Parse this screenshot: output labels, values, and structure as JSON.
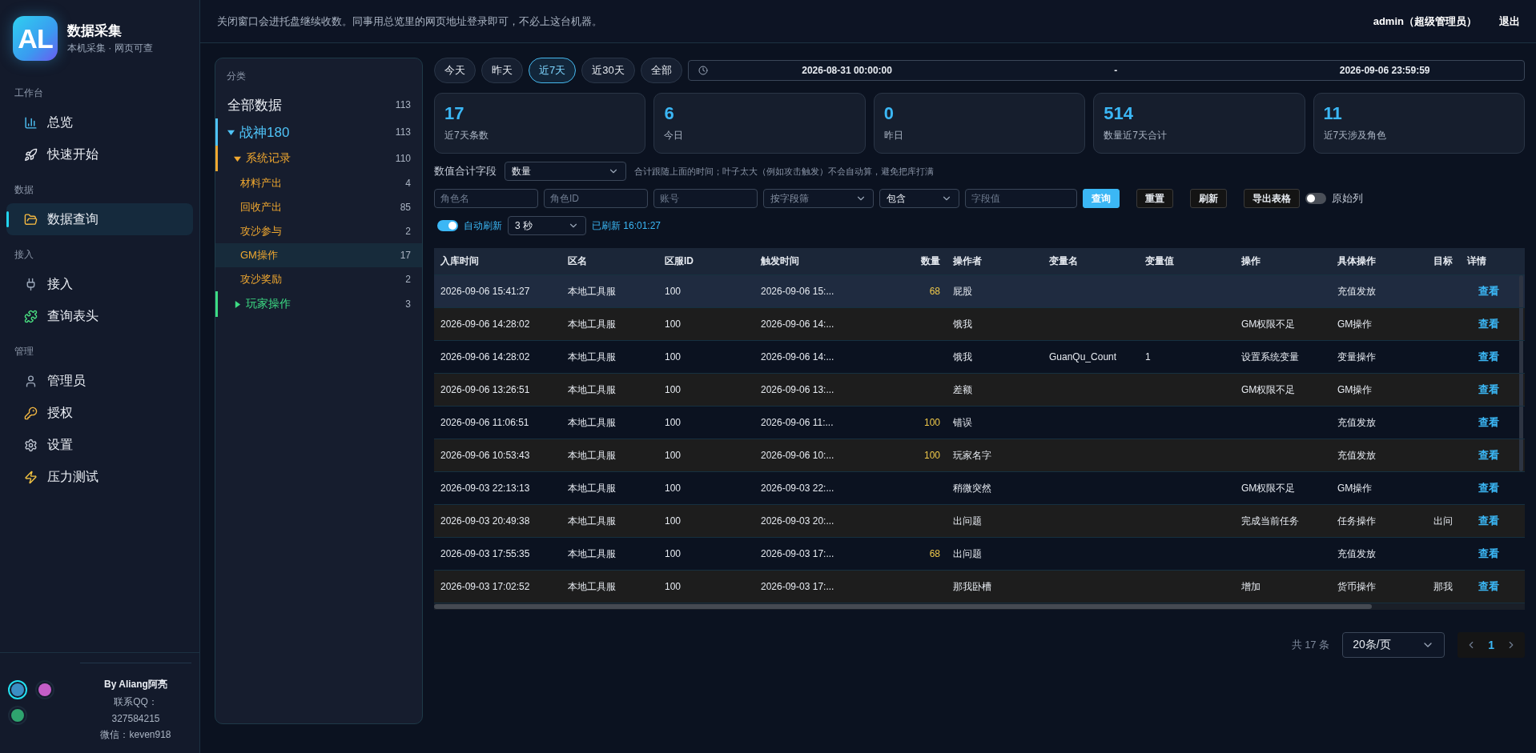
{
  "app": {
    "logo": "AL",
    "title": "数据采集",
    "subtitle": "本机采集 · 网页可查"
  },
  "nav": [
    {
      "section": "工作台",
      "items": [
        {
          "label": "总览",
          "selected": false
        },
        {
          "label": "快速开始",
          "selected": false
        }
      ]
    },
    {
      "section": "数据",
      "items": [
        {
          "label": "数据查询",
          "selected": true
        }
      ]
    },
    {
      "section": "接入",
      "items": [
        {
          "label": "接入",
          "selected": false
        },
        {
          "label": "查询表头",
          "selected": false
        }
      ]
    },
    {
      "section": "管理",
      "items": [
        {
          "label": "管理员",
          "selected": false
        },
        {
          "label": "授权",
          "selected": false
        },
        {
          "label": "设置",
          "selected": false
        },
        {
          "label": "压力测试",
          "selected": false
        }
      ]
    }
  ],
  "themes": [
    {
      "color": "#3a8fc4",
      "selected": true
    },
    {
      "color": "#c45ec8",
      "selected": false
    },
    {
      "color": "#2fa36e",
      "selected": false
    }
  ],
  "credits": {
    "author": "By Aliang阿亮",
    "qq_label": "联系QQ：",
    "qq": "327584215",
    "wechat": "微信：keven918"
  },
  "header": {
    "notice": "关闭窗口会进托盘继续收数。同事用总览里的网页地址登录即可，不必上这台机器。",
    "user": "admin（超级管理员）",
    "logout": "退出"
  },
  "categories": {
    "title": "分类",
    "tree": [
      {
        "label": "全部数据",
        "count": "113",
        "selected": false
      },
      {
        "label": "战神180",
        "count": "113",
        "color": "#4fc3f7",
        "expanded": true,
        "selected": false,
        "children": [
          {
            "label": "系统记录",
            "count": "110",
            "color": "#f0a830",
            "expanded": true,
            "selected": false,
            "children": [
              {
                "label": "材料产出",
                "count": "4",
                "selected": false
              },
              {
                "label": "回收产出",
                "count": "85",
                "selected": false
              },
              {
                "label": "攻沙参与",
                "count": "2",
                "selected": false
              },
              {
                "label": "GM操作",
                "count": "17",
                "selected": true
              },
              {
                "label": "攻沙奖励",
                "count": "2",
                "selected": false
              }
            ]
          },
          {
            "label": "玩家操作",
            "count": "3",
            "color": "#3ddc84",
            "expanded": false,
            "selected": false
          }
        ]
      }
    ]
  },
  "ranges": [
    {
      "label": "今天",
      "selected": false
    },
    {
      "label": "昨天",
      "selected": false
    },
    {
      "label": "近7天",
      "selected": true
    },
    {
      "label": "近30天",
      "selected": false
    },
    {
      "label": "全部",
      "selected": false
    }
  ],
  "date_range": {
    "start": "2026-08-31 00:00:00",
    "separator": "-",
    "end": "2026-09-06 23:59:59"
  },
  "stats": [
    {
      "value": "17",
      "label": "近7天条数"
    },
    {
      "value": "6",
      "label": "今日"
    },
    {
      "value": "0",
      "label": "昨日"
    },
    {
      "value": "514",
      "label": "数量近7天合计"
    },
    {
      "value": "11",
      "label": "近7天涉及角色"
    }
  ],
  "sum_field": {
    "label": "数值合计字段",
    "value": "数量",
    "hint": "合计跟随上面的时间；叶子太大（例如攻击触发）不会自动算，避免把库打满"
  },
  "filters": {
    "role_name": {
      "placeholder": "角色名"
    },
    "role_id": {
      "placeholder": "角色ID"
    },
    "account": {
      "placeholder": "账号"
    },
    "field_select": {
      "placeholder": "按字段筛"
    },
    "match_select": {
      "value": "包含"
    },
    "field_value": {
      "placeholder": "字段值"
    },
    "buttons": [
      {
        "label": "查询",
        "kind": "primary"
      },
      {
        "label": "重置",
        "kind": "plain"
      },
      {
        "label": "刷新",
        "kind": "plain"
      },
      {
        "label": "导出表格",
        "kind": "plain"
      }
    ],
    "raw_columns": {
      "label": "原始列",
      "on": false
    }
  },
  "auto_refresh": {
    "label": "自动刷新",
    "on": true,
    "interval": "3 秒",
    "status": "已刷新 16:01:27"
  },
  "table": {
    "columns": [
      "入库时间",
      "区名",
      "区服ID",
      "触发时间",
      "数量",
      "操作者",
      "变量名",
      "变量值",
      "操作",
      "具体操作",
      "目标",
      "详情"
    ],
    "rows": [
      {
        "selected": true,
        "cells": [
          "2026-09-06 15:41:27",
          "本地工具服",
          "100",
          "2026-09-06 15:...",
          "68",
          "屁股",
          "",
          "",
          "",
          "充值发放",
          "",
          "查看"
        ]
      },
      {
        "selected": false,
        "cells": [
          "2026-09-06 14:28:02",
          "本地工具服",
          "100",
          "2026-09-06 14:...",
          "",
          "饿我",
          "",
          "",
          "GM权限不足",
          "GM操作",
          "",
          "查看"
        ]
      },
      {
        "selected": false,
        "cells": [
          "2026-09-06 14:28:02",
          "本地工具服",
          "100",
          "2026-09-06 14:...",
          "",
          "饿我",
          "GuanQu_Count",
          "1",
          "设置系统变量",
          "变量操作",
          "",
          "查看"
        ]
      },
      {
        "selected": false,
        "cells": [
          "2026-09-06 13:26:51",
          "本地工具服",
          "100",
          "2026-09-06 13:...",
          "",
          "差额",
          "",
          "",
          "GM权限不足",
          "GM操作",
          "",
          "查看"
        ]
      },
      {
        "selected": false,
        "cells": [
          "2026-09-06 11:06:51",
          "本地工具服",
          "100",
          "2026-09-06 11:...",
          "100",
          "错误",
          "",
          "",
          "",
          "充值发放",
          "",
          "查看"
        ]
      },
      {
        "selected": false,
        "cells": [
          "2026-09-06 10:53:43",
          "本地工具服",
          "100",
          "2026-09-06 10:...",
          "100",
          "玩家名字",
          "",
          "",
          "",
          "充值发放",
          "",
          "查看"
        ]
      },
      {
        "selected": false,
        "cells": [
          "2026-09-03 22:13:13",
          "本地工具服",
          "100",
          "2026-09-03 22:...",
          "",
          "稍微突然",
          "",
          "",
          "GM权限不足",
          "GM操作",
          "",
          "查看"
        ]
      },
      {
        "selected": false,
        "cells": [
          "2026-09-03 20:49:38",
          "本地工具服",
          "100",
          "2026-09-03 20:...",
          "",
          "出问题",
          "",
          "",
          "完成当前任务",
          "任务操作",
          "出问",
          "查看"
        ]
      },
      {
        "selected": false,
        "cells": [
          "2026-09-03 17:55:35",
          "本地工具服",
          "100",
          "2026-09-03 17:...",
          "68",
          "出问题",
          "",
          "",
          "",
          "充值发放",
          "",
          "查看"
        ]
      },
      {
        "selected": false,
        "cells": [
          "2026-09-03 17:02:52",
          "本地工具服",
          "100",
          "2026-09-03 17:...",
          "",
          "那我卧槽",
          "",
          "",
          "增加",
          "货币操作",
          "那我",
          "查看"
        ]
      }
    ]
  },
  "pagination": {
    "total": "共 17 条",
    "page_size": "20条/页",
    "pages": [
      {
        "label": "1",
        "selected": true
      }
    ]
  }
}
